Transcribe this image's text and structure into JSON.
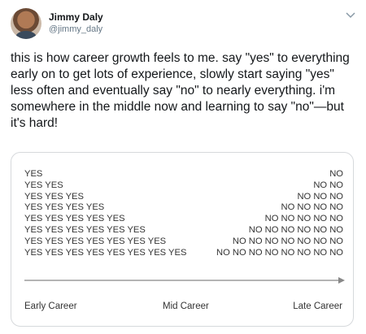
{
  "author": {
    "name": "Jimmy Daly",
    "handle": "@jimmy_daly"
  },
  "tweet_text": "this is how career growth feels to me. say \"yes\" to everything early on to get lots of experience, slowly start saying \"yes\" less often and eventually say \"no\" to nearly everything. i'm somewhere in the middle now and learning to say \"no\"—but it's hard!",
  "card": {
    "rows": [
      {
        "yes": "YES",
        "no": "NO"
      },
      {
        "yes": "YES YES",
        "no": "NO NO"
      },
      {
        "yes": "YES YES YES",
        "no": "NO NO NO"
      },
      {
        "yes": "YES YES YES YES",
        "no": "NO NO NO NO"
      },
      {
        "yes": "YES YES YES YES YES",
        "no": "NO NO NO NO NO"
      },
      {
        "yes": "YES YES YES YES YES YES",
        "no": "NO NO NO NO NO NO"
      },
      {
        "yes": "YES YES YES YES YES YES YES",
        "no": "NO NO NO NO NO NO NO"
      },
      {
        "yes": "YES YES YES YES YES YES YES YES",
        "no": "NO NO NO NO NO NO NO NO"
      }
    ],
    "axis_labels": {
      "early": "Early Career",
      "mid": "Mid Career",
      "late": "Late Career"
    }
  },
  "icons": {
    "menu": "chevron-down-icon",
    "arrow": "arrow-right-icon"
  },
  "colors": {
    "text": "#14171a",
    "secondary": "#657786",
    "border": "#d6d9dc",
    "arrow": "#888888"
  }
}
